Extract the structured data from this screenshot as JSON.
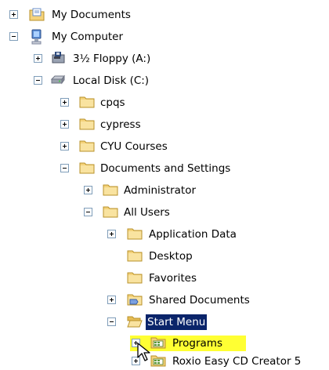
{
  "tree": {
    "items": [
      {
        "label": "My Documents",
        "icon": "my-documents-icon",
        "toggle": "plus"
      },
      {
        "label": "My Computer",
        "icon": "my-computer-icon",
        "toggle": "minus"
      },
      {
        "label": "3½ Floppy (A:)",
        "icon": "floppy-drive-icon",
        "toggle": "plus"
      },
      {
        "label": "Local Disk (C:)",
        "icon": "hard-disk-icon",
        "toggle": "minus"
      },
      {
        "label": "cpqs",
        "icon": "folder-icon",
        "toggle": "plus"
      },
      {
        "label": "cypress",
        "icon": "folder-icon",
        "toggle": "plus"
      },
      {
        "label": "CYU Courses",
        "icon": "folder-icon",
        "toggle": "plus"
      },
      {
        "label": "Documents and Settings",
        "icon": "folder-icon",
        "toggle": "minus"
      },
      {
        "label": "Administrator",
        "icon": "folder-icon",
        "toggle": "plus"
      },
      {
        "label": "All Users",
        "icon": "folder-icon",
        "toggle": "minus"
      },
      {
        "label": "Application Data",
        "icon": "folder-icon",
        "toggle": "plus"
      },
      {
        "label": "Desktop",
        "icon": "folder-icon",
        "toggle": "none"
      },
      {
        "label": "Favorites",
        "icon": "folder-icon",
        "toggle": "none"
      },
      {
        "label": "Shared Documents",
        "icon": "shared-folder-icon",
        "toggle": "plus"
      },
      {
        "label": "Start Menu",
        "icon": "open-folder-icon",
        "toggle": "minus",
        "state": "selected"
      },
      {
        "label": "Programs",
        "icon": "programs-folder-icon",
        "toggle": "plus",
        "state": "highlighted"
      },
      {
        "label": "Roxio Easy CD Creator 5",
        "icon": "programs-folder-icon",
        "toggle": "plus"
      }
    ]
  },
  "colors": {
    "selection_background": "#0a246a",
    "selection_text": "#ffffff",
    "highlight_background": "#ffff33",
    "folder_yellow": "#f4d27a",
    "toggle_border": "#7f9db9"
  }
}
